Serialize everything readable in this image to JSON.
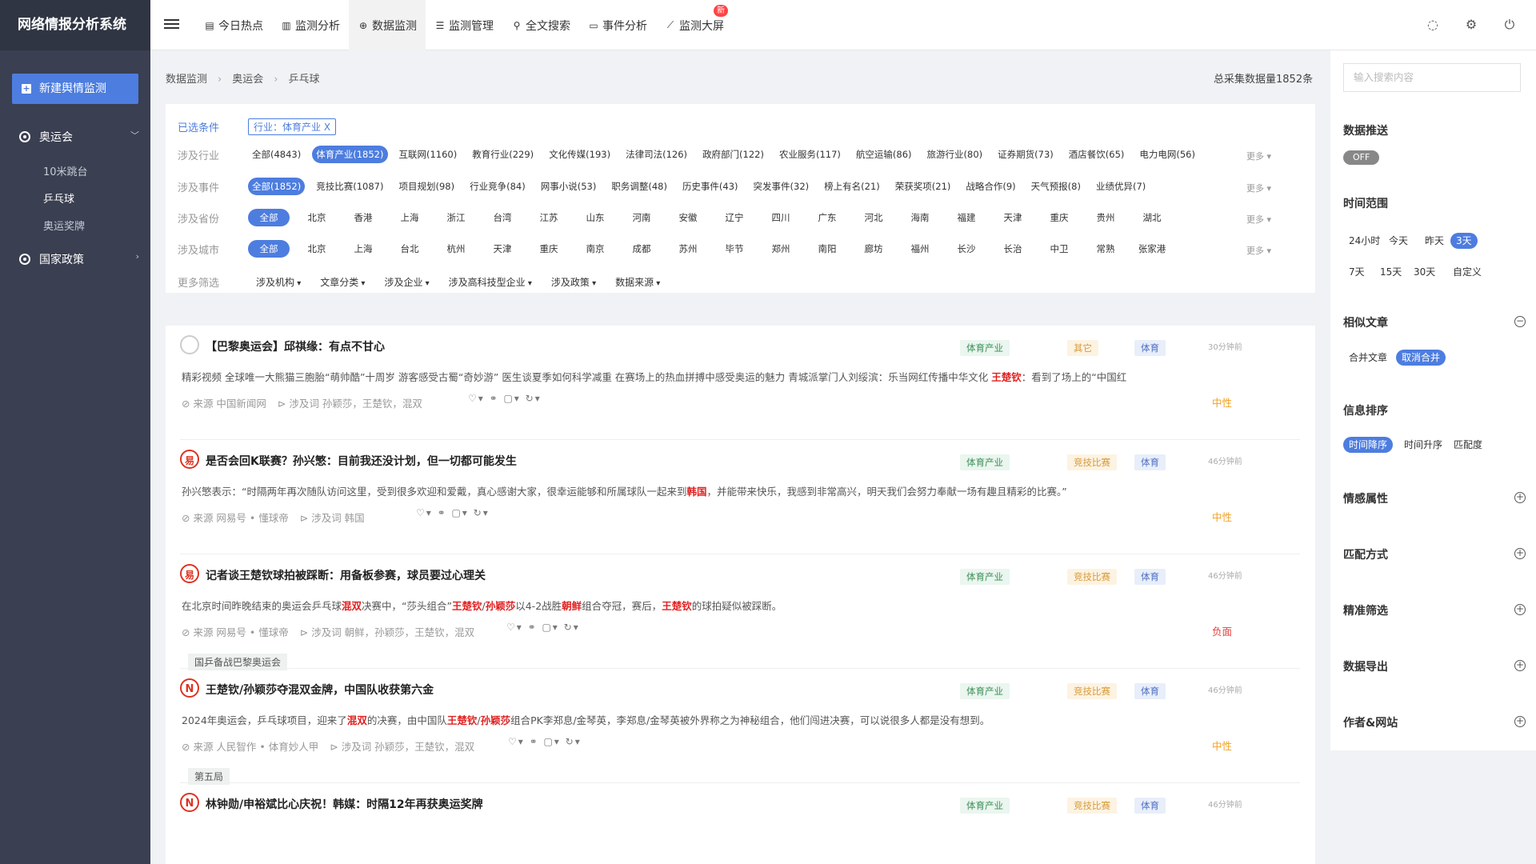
{
  "app": {
    "title": "网络情报分析系统"
  },
  "nav": [
    {
      "icon": "list-icon",
      "glyph": "▤",
      "label": "今日热点"
    },
    {
      "icon": "bar-chart-icon",
      "glyph": "▥",
      "label": "监测分析"
    },
    {
      "icon": "crosshair-icon",
      "glyph": "⊕",
      "label": "数据监测"
    },
    {
      "icon": "list-bullet-icon",
      "glyph": "☰",
      "label": "监测管理"
    },
    {
      "icon": "search-icon",
      "glyph": "⚲",
      "label": "全文搜索"
    },
    {
      "icon": "card-icon",
      "glyph": "▭",
      "label": "事件分析"
    },
    {
      "icon": "line-chart-icon",
      "glyph": "⟋",
      "label": "监测大屏",
      "badge": "新"
    }
  ],
  "sidebar": {
    "new_button": "新建舆情监测",
    "groups": [
      {
        "label": "奥运会",
        "children": [
          "10米跳台",
          "乒乓球",
          "奥运奖牌"
        ]
      },
      {
        "label": "国家政策"
      }
    ]
  },
  "breadcrumb": [
    "数据监测",
    "奥运会",
    "乒乓球"
  ],
  "total": "总采集数据量1852条",
  "filters": {
    "selected_label": "已选条件",
    "selected_tag": "行业：体育产业 X",
    "more": "更多",
    "rows": [
      {
        "label": "涉及行业",
        "chips": [
          "全部(4843)",
          "体育产业(1852)",
          "互联网(1160)",
          "教育行业(229)",
          "文化传媒(193)",
          "法律司法(126)",
          "政府部门(122)",
          "农业服务(117)",
          "航空运输(86)",
          "旅游行业(80)",
          "证券期货(73)",
          "酒店餐饮(65)",
          "电力电网(56)"
        ],
        "selected": 1
      },
      {
        "label": "涉及事件",
        "chips": [
          "全部(1852)",
          "竞技比赛(1087)",
          "项目规划(98)",
          "行业竞争(84)",
          "网事小说(53)",
          "职务调整(48)",
          "历史事件(43)",
          "突发事件(32)",
          "榜上有名(21)",
          "荣获奖项(21)",
          "战略合作(9)",
          "天气预报(8)",
          "业绩优异(7)"
        ],
        "selected": 0
      },
      {
        "label": "涉及省份",
        "chips": [
          "全部",
          "北京",
          "香港",
          "上海",
          "浙江",
          "台湾",
          "江苏",
          "山东",
          "河南",
          "安徽",
          "辽宁",
          "四川",
          "广东",
          "河北",
          "海南",
          "福建",
          "天津",
          "重庆",
          "贵州",
          "湖北"
        ],
        "selected": 0
      },
      {
        "label": "涉及城市",
        "chips": [
          "全部",
          "北京",
          "上海",
          "台北",
          "杭州",
          "天津",
          "重庆",
          "南京",
          "成都",
          "苏州",
          "毕节",
          "郑州",
          "南阳",
          "廊坊",
          "福州",
          "长沙",
          "长治",
          "中卫",
          "常熟",
          "张家港"
        ],
        "selected": 0
      }
    ],
    "more_label": "更多筛选",
    "dropdowns": [
      "涉及机构",
      "文章分类",
      "涉及企业",
      "涉及高科技型企业",
      "涉及政策",
      "数据来源"
    ]
  },
  "articles": [
    {
      "avatar": "ring",
      "title": "【巴黎奥运会】邱祺缘：有点不甘心",
      "summary": [
        {
          "t": "精彩视频 全球唯一大熊猫三胞胎“萌帅酷”十周岁 游客感受古蜀“奇妙游” 医生谈夏季如何科学减重 在赛场上的热血拼搏中感受奥运的魅力 青城派掌门人刘绥滨：乐当网红传播中华文化 "
        },
        {
          "t": "王楚钦",
          "h": 1
        },
        {
          "t": "：看到了场上的“中国红"
        }
      ],
      "source": "来源 中国新闻网",
      "words": "涉及词 孙颖莎，王楚钦，混双",
      "tags": [
        "体育产业",
        "其它",
        "体育"
      ],
      "time": "30分钟前",
      "sentiment": "中性",
      "extra": ""
    },
    {
      "avatar": "wy",
      "title": "是否会回K联赛？孙兴慜：目前我还没计划，但一切都可能发生",
      "summary": [
        {
          "t": "孙兴慜表示：“时隔两年再次随队访问这里，受到很多欢迎和爱戴，真心感谢大家，很幸运能够和所属球队一起来到"
        },
        {
          "t": "韩国",
          "h": 1
        },
        {
          "t": "，并能带来快乐，我感到非常高兴，明天我们会努力奉献一场有趣且精彩的比赛。”"
        }
      ],
      "source": "来源 网易号 • 懂球帝",
      "words": "涉及词 韩国",
      "tags": [
        "体育产业",
        "竞技比赛",
        "体育"
      ],
      "time": "46分钟前",
      "sentiment": "中性",
      "extra": ""
    },
    {
      "avatar": "wy",
      "title": "记者谈王楚钦球拍被踩断：用备板参赛，球员要过心理关",
      "summary": [
        {
          "t": "在北京时间昨晚结束的奥运会乒乓球"
        },
        {
          "t": "混双",
          "h": 1
        },
        {
          "t": "决赛中，“莎头组合”"
        },
        {
          "t": "王楚钦",
          "h": 1
        },
        {
          "t": "/"
        },
        {
          "t": "孙颖莎",
          "h": 1
        },
        {
          "t": "以4-2战胜"
        },
        {
          "t": "朝鲜",
          "h": 1
        },
        {
          "t": "组合夺冠，赛后，"
        },
        {
          "t": "王楚钦",
          "h": 1
        },
        {
          "t": "的球拍疑似被踩断。"
        }
      ],
      "source": "来源 网易号 • 懂球帝",
      "words": "涉及词 朝鲜，孙颖莎，王楚钦，混双",
      "tags": [
        "体育产业",
        "竞技比赛",
        "体育"
      ],
      "time": "46分钟前",
      "sentiment": "负面",
      "extra": "国乒备战巴黎奥运会"
    },
    {
      "avatar": "rm",
      "title": "王楚钦/孙颖莎夺混双金牌，中国队收获第六金",
      "summary": [
        {
          "t": "2024年奥运会，乒乓球项目，迎来了"
        },
        {
          "t": "混双",
          "h": 1
        },
        {
          "t": "的决赛，由中国队"
        },
        {
          "t": "王楚钦",
          "h": 1
        },
        {
          "t": "/"
        },
        {
          "t": "孙颖莎",
          "h": 1
        },
        {
          "t": "组合PK李郑息/金琴英，李郑息/金琴英被外界称之为神秘组合，他们闯进决赛，可以说很多人都是没有想到。"
        }
      ],
      "source": "来源 人民智作 • 体育妙人甲",
      "words": "涉及词 孙颖莎，王楚钦，混双",
      "tags": [
        "体育产业",
        "竞技比赛",
        "体育"
      ],
      "time": "46分钟前",
      "sentiment": "中性",
      "extra": "第五局"
    },
    {
      "avatar": "rm",
      "title": "林钟勋/申裕斌比心庆祝！韩媒：时隔12年再获奥运奖牌",
      "summary": [],
      "source": "",
      "words": "",
      "tags": [
        "体育产业",
        "竞技比赛",
        "体育"
      ],
      "time": "46分钟前",
      "sentiment": "",
      "extra": ""
    }
  ],
  "right": {
    "search_placeholder": "输入搜索内容",
    "push": {
      "title": "数据推送",
      "toggle": "OFF"
    },
    "time": {
      "title": "时间范围",
      "options": [
        "24小时",
        "今天",
        "昨天",
        "3天",
        "7天",
        "15天",
        "30天",
        "自定义"
      ],
      "selected": "3天"
    },
    "similar": {
      "title": "相似文章",
      "options": [
        "合并文章",
        "取消合并"
      ],
      "selected": "取消合并"
    },
    "sort": {
      "title": "信息排序",
      "options": [
        "时间降序",
        "时间升序",
        "匹配度"
      ],
      "selected": "时间降序"
    },
    "sections": [
      "情感属性",
      "匹配方式",
      "精准筛选",
      "数据导出",
      "作者&网站"
    ]
  },
  "colors": {
    "accent": "#4d7ddf",
    "sidebar": "#3a3f51",
    "logo": "#2f3542",
    "highlight": "#e02020",
    "neutral": "#f0a020",
    "negative": "#e04040"
  }
}
